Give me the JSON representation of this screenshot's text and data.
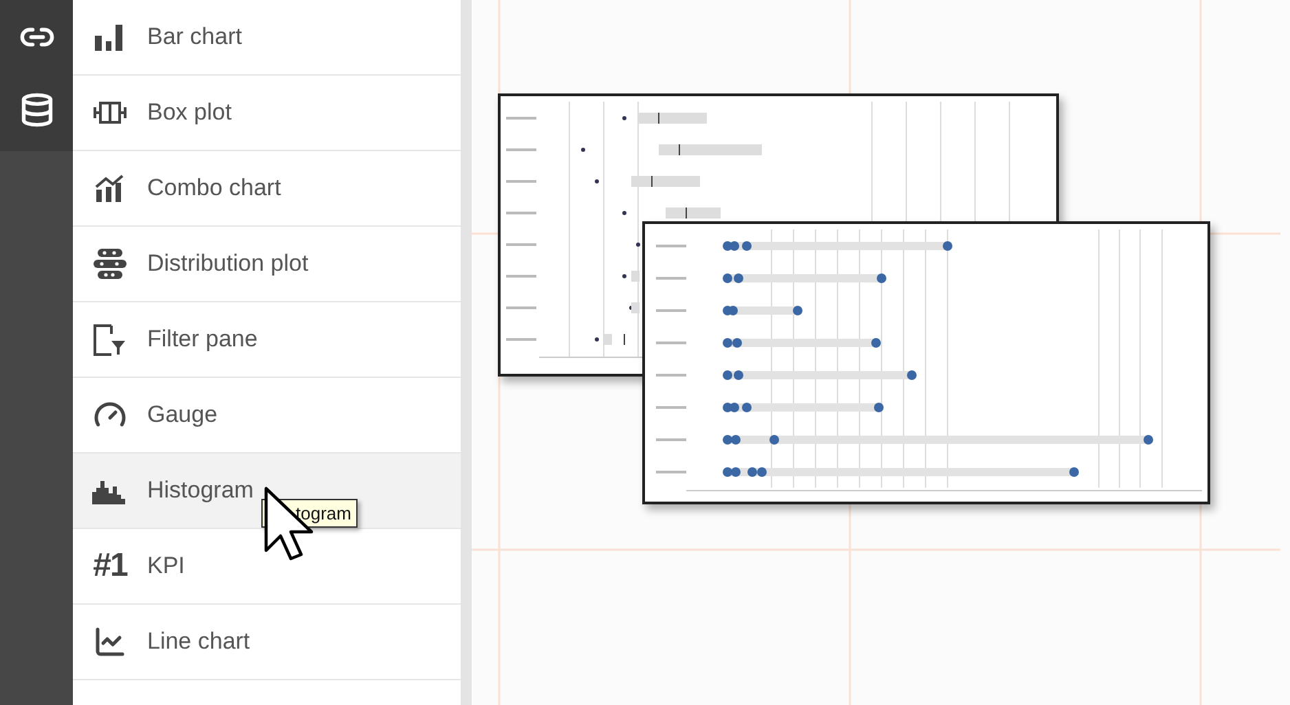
{
  "chart_types": [
    {
      "label": "Bar chart",
      "highlighted": false
    },
    {
      "label": "Box plot",
      "highlighted": false
    },
    {
      "label": "Combo chart",
      "highlighted": false
    },
    {
      "label": "Distribution plot",
      "highlighted": false
    },
    {
      "label": "Filter pane",
      "highlighted": false
    },
    {
      "label": "Gauge",
      "highlighted": false
    },
    {
      "label": "Histogram",
      "highlighted": true
    },
    {
      "label": "KPI",
      "highlighted": false,
      "icon_text": "#1"
    },
    {
      "label": "Line chart",
      "highlighted": false
    }
  ],
  "tooltip": {
    "text": "togram"
  }
}
